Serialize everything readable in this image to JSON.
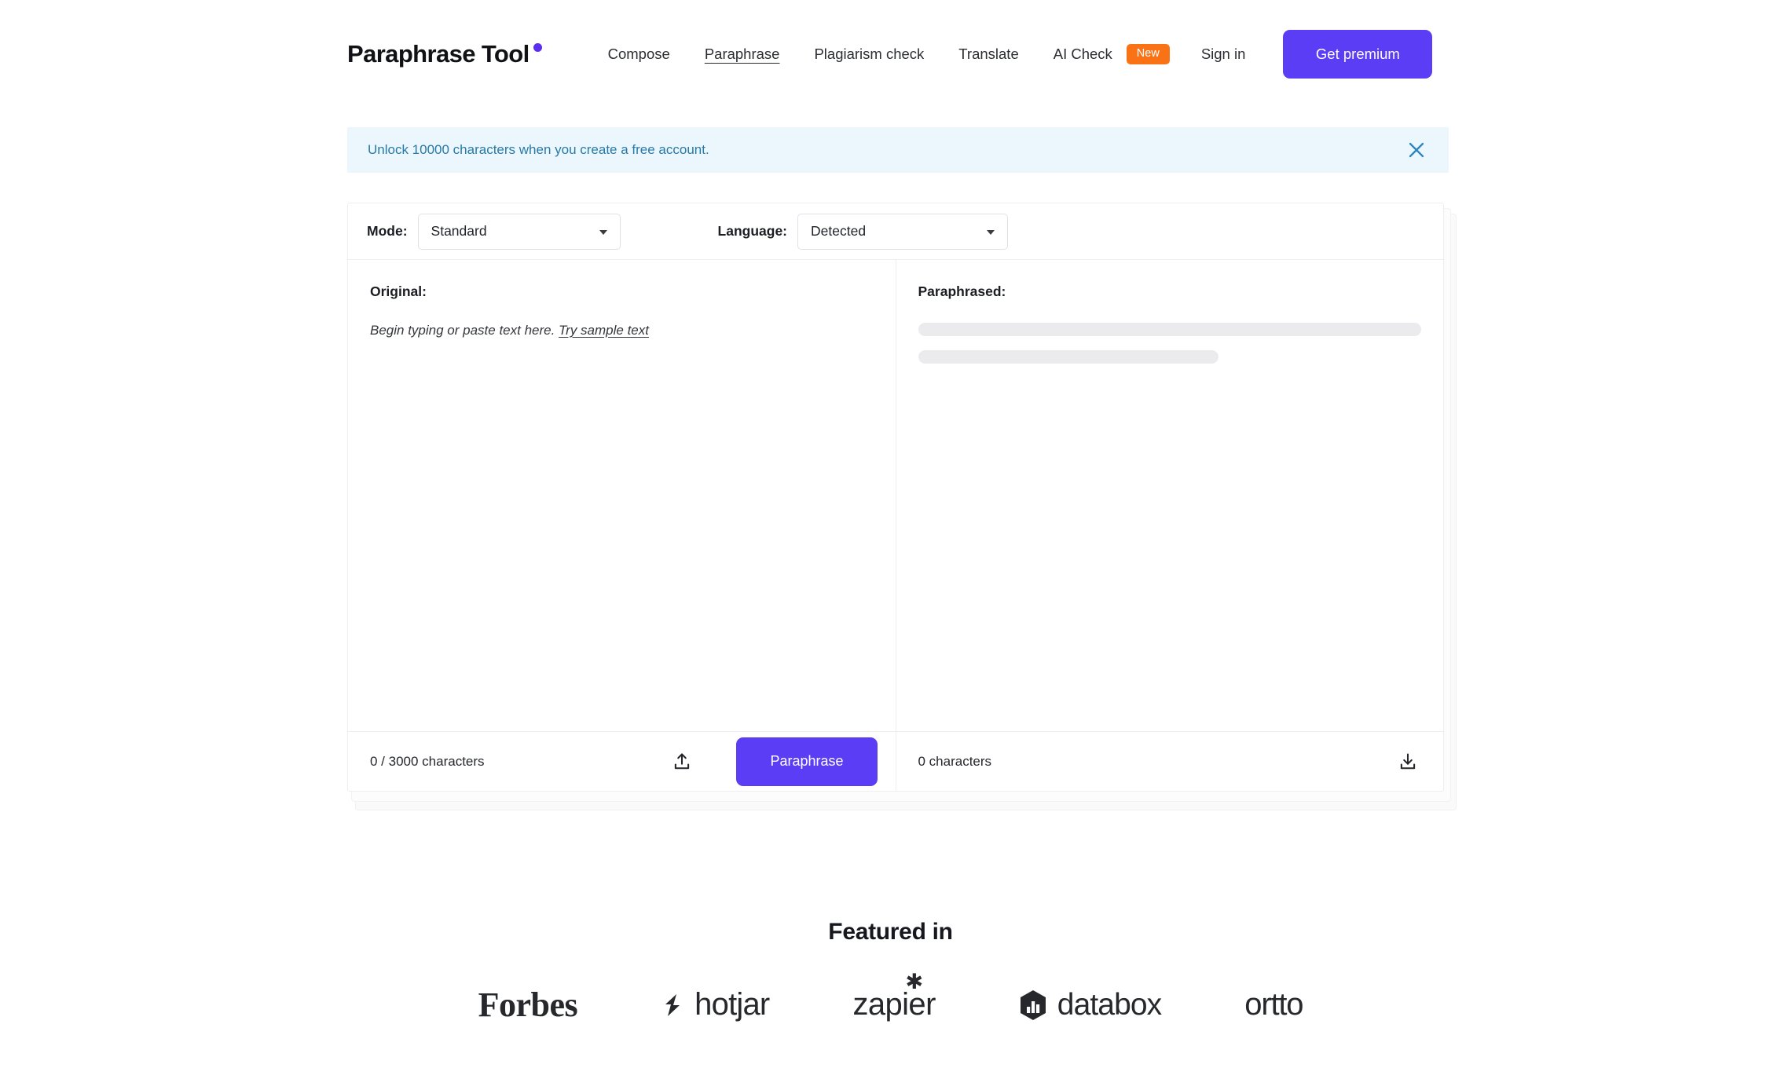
{
  "header": {
    "brand": "Paraphrase Tool",
    "brand_dot_color": "#5b2df0",
    "nav_items": [
      {
        "label": "Compose",
        "active": false
      },
      {
        "label": "Paraphrase",
        "active": true
      },
      {
        "label": "Plagiarism check",
        "active": false
      },
      {
        "label": "Translate",
        "active": false
      }
    ],
    "ai_check": {
      "label": "AI Check",
      "badge": "New",
      "badge_color": "#f97316"
    },
    "sign_in": "Sign in",
    "premium_button": "Get premium",
    "premium_color": "#5b3df5"
  },
  "notice": {
    "message": "Unlock 10000 characters when you create a free account.",
    "background": "#ecf7fd",
    "text_color": "#2779a8",
    "close_icon": "close-icon"
  },
  "toolbar": {
    "mode_label": "Mode:",
    "mode_value": "Standard",
    "language_label": "Language:",
    "language_value": "Detected",
    "caret_icon": "chevron-down-icon"
  },
  "editor": {
    "original_label": "Original:",
    "placeholder_text": "Begin typing or paste text here.",
    "sample_link": "Try sample text",
    "paraphrased_label": "Paraphrased:"
  },
  "footer": {
    "input_counter": "0 / 3000 characters",
    "output_counter": "0 characters",
    "upload_icon": "upload-icon",
    "download_icon": "download-icon",
    "paraphrase_button": "Paraphrase"
  },
  "featured": {
    "title": "Featured in",
    "logos": [
      {
        "name": "Forbes",
        "text": "Forbes"
      },
      {
        "name": "hotjar",
        "text": "hotjar"
      },
      {
        "name": "zapier",
        "text": "zapier"
      },
      {
        "name": "databox",
        "text": "databox"
      },
      {
        "name": "ortto",
        "text": "ortto"
      }
    ]
  }
}
